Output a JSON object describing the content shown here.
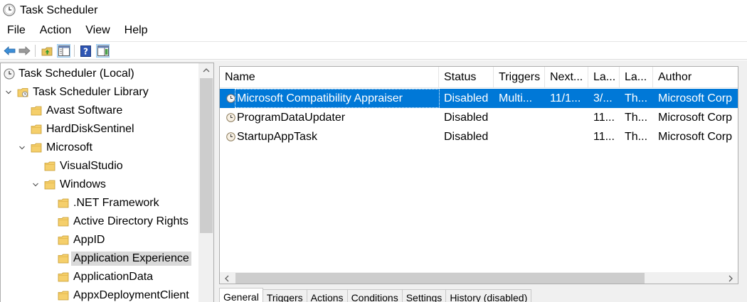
{
  "window": {
    "title": "Task Scheduler",
    "icon": "clock-icon"
  },
  "menu": [
    "File",
    "Action",
    "View",
    "Help"
  ],
  "toolbar": {
    "buttons": [
      "back-arrow-icon",
      "forward-arrow-icon",
      "up-folder-icon",
      "show-hide-console-tree-icon",
      "help-icon",
      "show-hide-action-pane-icon"
    ]
  },
  "tree": {
    "items": [
      {
        "label": "Task Scheduler (Local)",
        "icon": "clock-icon",
        "expanded": null
      },
      {
        "label": "Task Scheduler Library",
        "icon": "library-folder-icon",
        "expanded": true
      },
      {
        "label": "Avast Software",
        "icon": "folder-icon",
        "expanded": null
      },
      {
        "label": "HardDiskSentinel",
        "icon": "folder-icon",
        "expanded": null
      },
      {
        "label": "Microsoft",
        "icon": "folder-icon",
        "expanded": true
      },
      {
        "label": "VisualStudio",
        "icon": "folder-icon",
        "expanded": null
      },
      {
        "label": "Windows",
        "icon": "folder-icon",
        "expanded": true
      },
      {
        "label": ".NET Framework",
        "icon": "folder-icon",
        "expanded": null
      },
      {
        "label": "Active Directory Rights",
        "icon": "folder-icon",
        "expanded": null
      },
      {
        "label": "AppID",
        "icon": "folder-icon",
        "expanded": null
      },
      {
        "label": "Application Experience",
        "icon": "folder-icon",
        "expanded": null,
        "selected": true
      },
      {
        "label": "ApplicationData",
        "icon": "folder-icon",
        "expanded": null
      },
      {
        "label": "AppxDeploymentClient",
        "icon": "folder-icon",
        "expanded": null
      }
    ]
  },
  "task_list": {
    "columns": [
      "Name",
      "Status",
      "Triggers",
      "Next...",
      "La...",
      "La...",
      "Author"
    ],
    "rows": [
      {
        "name": "Microsoft Compatibility Appraiser",
        "status": "Disabled",
        "triggers": "Multi...",
        "next": "11/1...",
        "last_run": "3/...",
        "last_result": "Th...",
        "author": "Microsoft Corp",
        "selected": true
      },
      {
        "name": "ProgramDataUpdater",
        "status": "Disabled",
        "triggers": "",
        "next": "",
        "last_run": "11...",
        "last_result": "Th...",
        "author": "Microsoft Corp",
        "selected": false
      },
      {
        "name": "StartupAppTask",
        "status": "Disabled",
        "triggers": "",
        "next": "",
        "last_run": "11...",
        "last_result": "Th...",
        "author": "Microsoft Corp",
        "selected": false
      }
    ]
  },
  "detail_tabs": [
    "General",
    "Triggers",
    "Actions",
    "Conditions",
    "Settings",
    "History (disabled)"
  ],
  "colors": {
    "selection": "#0078d7",
    "tree_selection": "#d9d9d9",
    "folder": "#f5cf6b",
    "scroll_thumb": "#cdcdcd"
  }
}
